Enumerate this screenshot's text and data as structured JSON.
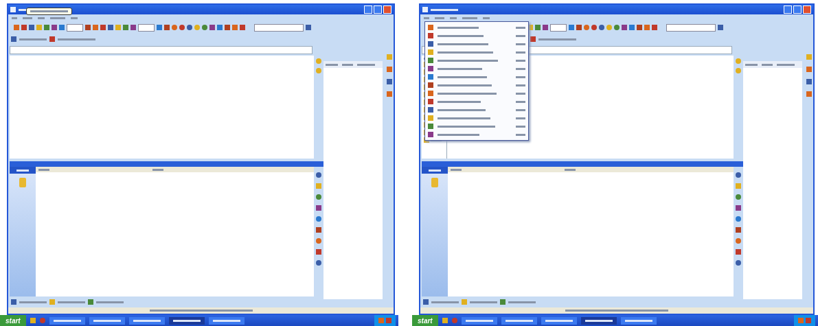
{
  "screens": [
    {
      "tooltip_shown": true,
      "dropdown_open": false,
      "tree_shown": false,
      "taskbar": {
        "start_label": "start"
      }
    },
    {
      "tooltip_shown": false,
      "dropdown_open": true,
      "tree_shown": true,
      "taskbar": {
        "start_label": "start"
      }
    }
  ]
}
